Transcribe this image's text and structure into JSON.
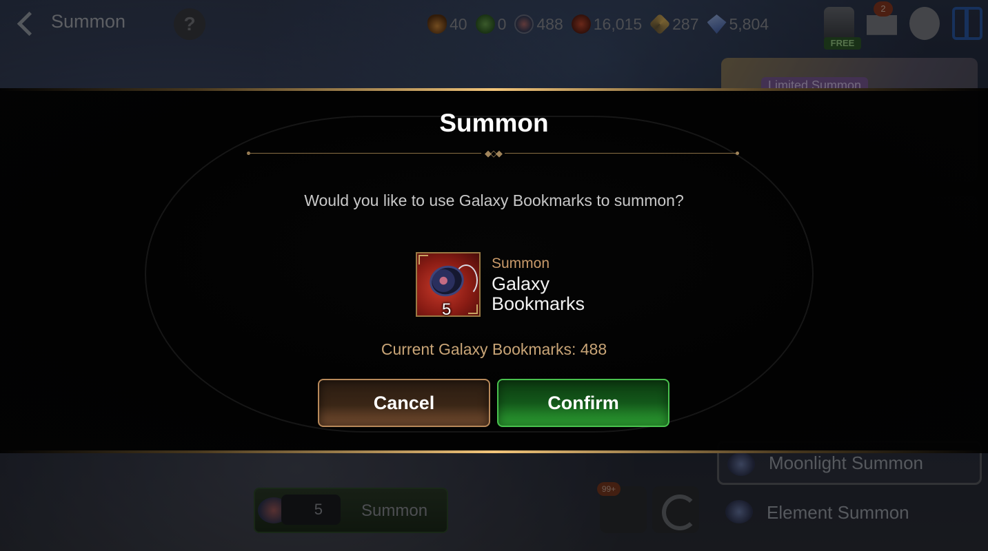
{
  "header": {
    "title": "Summon",
    "help_label": "?",
    "currencies": [
      {
        "icon": "flame-stamina-icon",
        "value": "40"
      },
      {
        "icon": "clover-icon",
        "value": "0"
      },
      {
        "icon": "galaxy-bookmark-icon",
        "value": "488"
      },
      {
        "icon": "gold-coin-icon",
        "value": "16,015"
      },
      {
        "icon": "molagora-icon",
        "value": "287"
      },
      {
        "icon": "skystone-icon",
        "value": "5,804"
      }
    ],
    "shop_free_label": "FREE",
    "mail_badge": "2"
  },
  "side_panel": {
    "banner_tag": "Limited Summon",
    "menu_items": [
      {
        "label": "Moonlight Summon",
        "active": true
      },
      {
        "label": "Element Summon",
        "active": false
      }
    ]
  },
  "bottom_bar": {
    "summon_count": "5",
    "summon_label": "Summon",
    "box_badge": "99+"
  },
  "dialog": {
    "title": "Summon",
    "question": "Would you like to use Galaxy Bookmarks to summon?",
    "item": {
      "category": "Summon",
      "name": "Galaxy Bookmarks",
      "quantity": "5"
    },
    "current_text": "Current Galaxy Bookmarks: 488",
    "cancel_label": "Cancel",
    "confirm_label": "Confirm"
  },
  "colors": {
    "confirm_green": "#13581a",
    "cancel_brown": "#3a2616",
    "gold_accent": "#f2c57a",
    "category_orange": "#c99a6a"
  }
}
